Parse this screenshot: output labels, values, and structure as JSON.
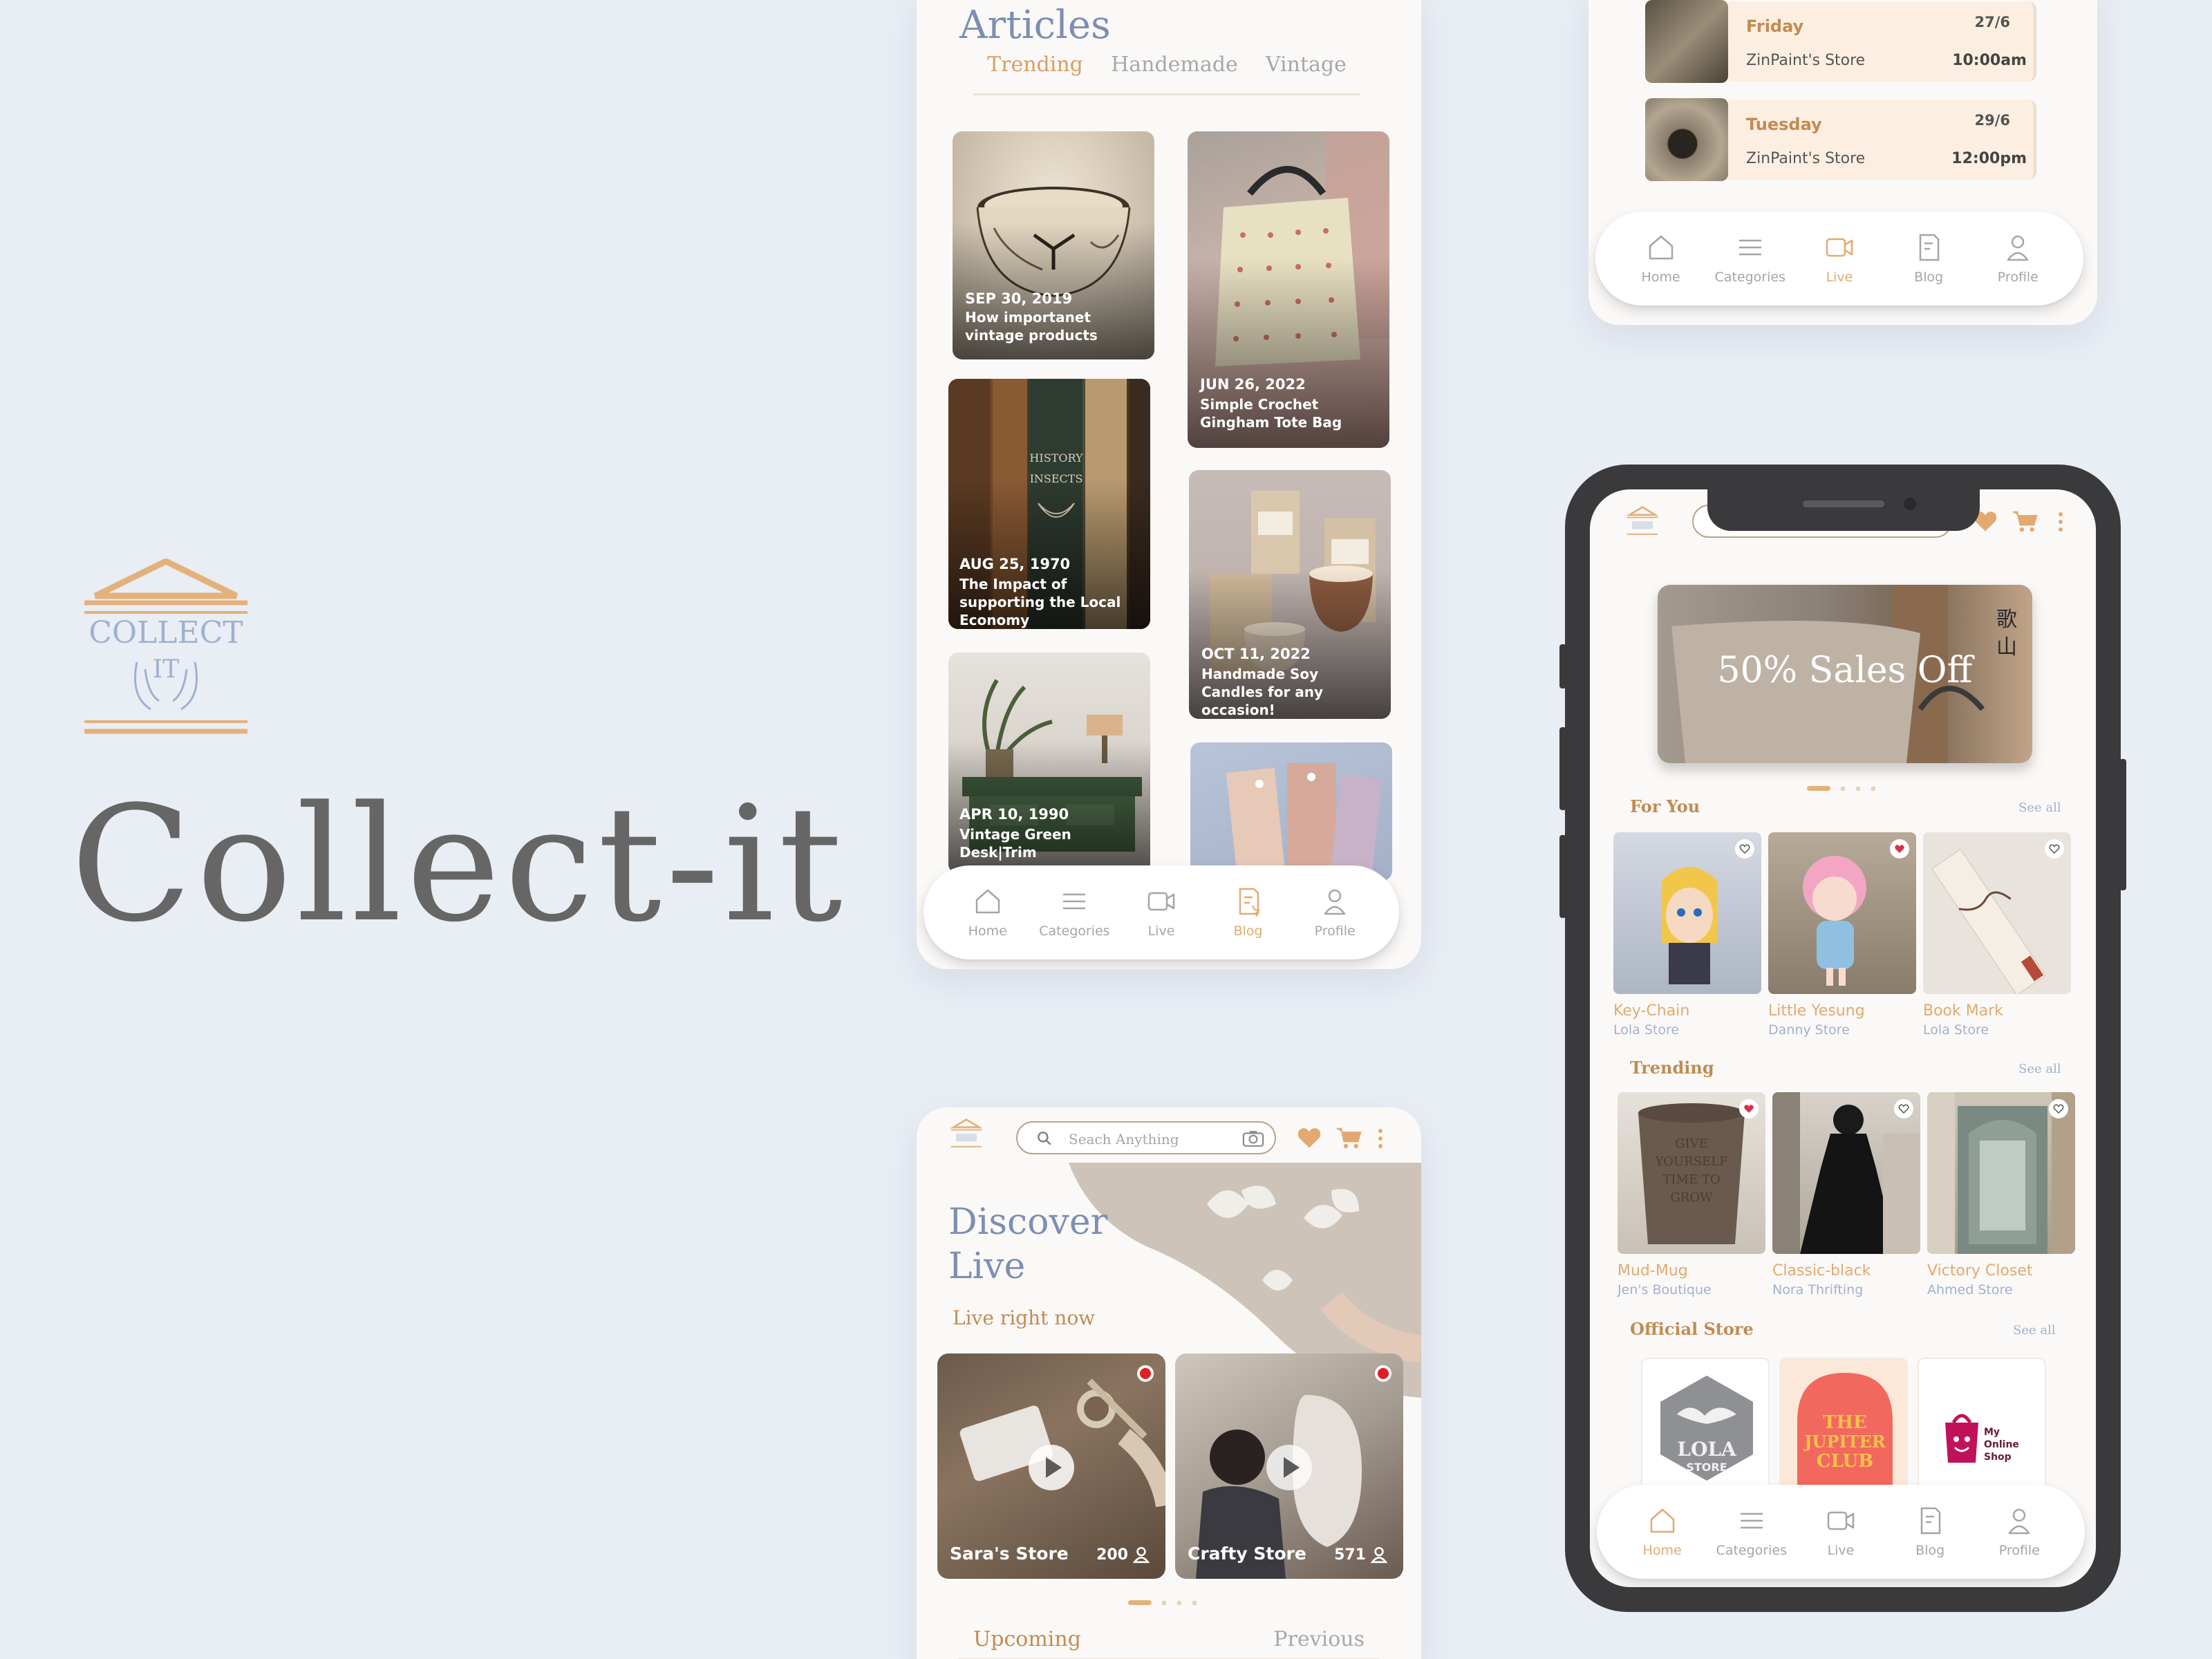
{
  "brand": {
    "logo_line1": "COLLECT",
    "logo_line2": "IT",
    "title": "Collect-it"
  },
  "colors": {
    "accent": "#e3a970",
    "accent_dark": "#c28b52",
    "title_blue": "#7c8fb3",
    "muted_blue": "#9fb1d1",
    "background": "#e9edf4"
  },
  "nav": [
    {
      "label": "Home",
      "icon": "home-icon"
    },
    {
      "label": "Categories",
      "icon": "menu-icon"
    },
    {
      "label": "Live",
      "icon": "video-icon"
    },
    {
      "label": "Blog",
      "icon": "blog-icon"
    },
    {
      "label": "Profile",
      "icon": "profile-icon"
    }
  ],
  "articles": {
    "title": "Articles",
    "tabs": [
      "Trending",
      "Handemade",
      "Vintage"
    ],
    "active_tab": "Trending",
    "active_nav": "Blog",
    "posts": [
      {
        "date": "SEP 30, 2019",
        "title": "How importanet vintage products"
      },
      {
        "date": "JUN 26, 2022",
        "title": "Simple Crochet Gingham Tote Bag"
      },
      {
        "date": "AUG 25, 1970",
        "title": "The Impact of supporting the Local Economy"
      },
      {
        "date": "OCT 11, 2022",
        "title": "Handmade Soy Candles for any occasion!"
      },
      {
        "date": "APR 10, 1990",
        "title": "Vintage Green Desk|Trim"
      }
    ]
  },
  "live_schedule": {
    "active_nav": "Live",
    "events": [
      {
        "day": "Friday",
        "date": "27/6",
        "store": "ZinPaint's Store",
        "time": "10:00am"
      },
      {
        "day": "Tuesday",
        "date": "29/6",
        "store": "ZinPaint's Store",
        "time": "12:00pm"
      }
    ]
  },
  "discover": {
    "search_placeholder": "Seach Anything",
    "title_line1": "Discover",
    "title_line2": "Live",
    "subtitle": "Live right now",
    "streams": [
      {
        "store": "Sara's Store",
        "viewers": "200"
      },
      {
        "store": "Crafty Store",
        "viewers": "571"
      }
    ],
    "tabs": [
      "Upcoming",
      "Previous"
    ],
    "active_tab": "Upcoming"
  },
  "home": {
    "banner_text": "50% Sales Off",
    "active_nav": "Home",
    "see_all": "See all",
    "sections": {
      "for_you": {
        "title": "For You",
        "items": [
          {
            "name": "Key-Chain",
            "store": "Lola Store",
            "favorited": false
          },
          {
            "name": "Little Yesung",
            "store": "Danny Store",
            "favorited": true
          },
          {
            "name": "Book Mark",
            "store": "Lola Store",
            "favorited": false
          }
        ]
      },
      "trending": {
        "title": "Trending",
        "items": [
          {
            "name": "Mud-Mug",
            "store": "Jen's Boutique",
            "favorited": true
          },
          {
            "name": "Classic-black",
            "store": "Nora Thrifting",
            "favorited": false
          },
          {
            "name": "Victory Closet",
            "store": "Ahmed Store",
            "favorited": false
          }
        ]
      },
      "official": {
        "title": "Official Store",
        "stores": [
          {
            "line1": "LOLA",
            "line2": "STORE"
          },
          {
            "line1": "THE",
            "line2": "JUPITER",
            "line3": "CLUB"
          },
          {
            "line1": "My",
            "line2": "Online",
            "line3": "Shop"
          }
        ]
      }
    }
  }
}
